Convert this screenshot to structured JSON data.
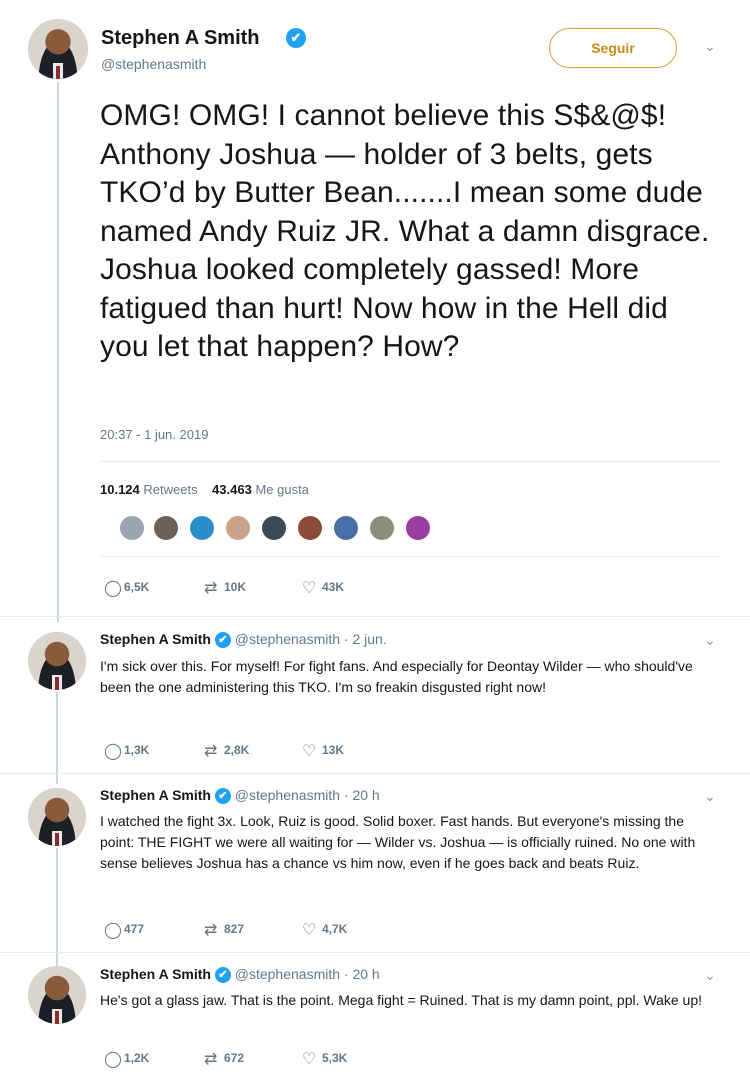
{
  "main_tweet": {
    "author_name": "Stephen A Smith",
    "handle": "@stephenasmith",
    "follow_label": "Seguir",
    "text": "OMG! OMG! I cannot believe this S$&@$! Anthony Joshua — holder of 3 belts, gets TKO’d by Butter Bean.......I mean some dude named Andy Ruiz JR. What a damn disgrace. Joshua looked completely gassed! More fatigued than hurt! Now how in the Hell did you let that happen? How?",
    "timestamp": "20:37 - 1 jun. 2019",
    "retweet_count": "10.124",
    "retweet_label": "Retweets",
    "like_count": "43.463",
    "like_label": "Me gusta",
    "replies": "6,5K",
    "retweets": "10K",
    "likes": "43K"
  },
  "replies": [
    {
      "author_name": "Stephen A Smith",
      "handle": "@stephenasmith",
      "time": "· 2 jun.",
      "text": "I'm sick over this. For myself! For fight fans. And especially for Deontay Wilder — who should've been the one administering this TKO. I'm so freakin disgusted right now!",
      "replies": "1,3K",
      "retweets": "2,8K",
      "likes": "13K"
    },
    {
      "author_name": "Stephen A Smith",
      "handle": "@stephenasmith",
      "time": "· 20 h",
      "text": "I watched the fight 3x. Look, Ruiz is good. Solid boxer. Fast hands. But everyone's missing the point: THE FIGHT we were all waiting for — Wilder vs. Joshua — is officially ruined. No one with sense believes Joshua has a chance vs him now, even if he goes back and beats Ruiz.",
      "replies": "477",
      "retweets": "827",
      "likes": "4,7K"
    },
    {
      "author_name": "Stephen A Smith",
      "handle": "@stephenasmith",
      "time": "· 20 h",
      "text": "He's got a glass jaw. That is the point. Mega fight = Ruined. That is my damn point, ppl. Wake up!",
      "replies": "1,2K",
      "retweets": "672",
      "likes": "5,3K"
    }
  ],
  "icons": {
    "verified": "✔",
    "chevron": "⌄",
    "reply": "◯",
    "retweet": "⇄",
    "like": "♡"
  },
  "colors": {
    "verified_blue": "#1da1f2",
    "follow_accent": "#d6a33a",
    "muted_text": "#657786"
  }
}
